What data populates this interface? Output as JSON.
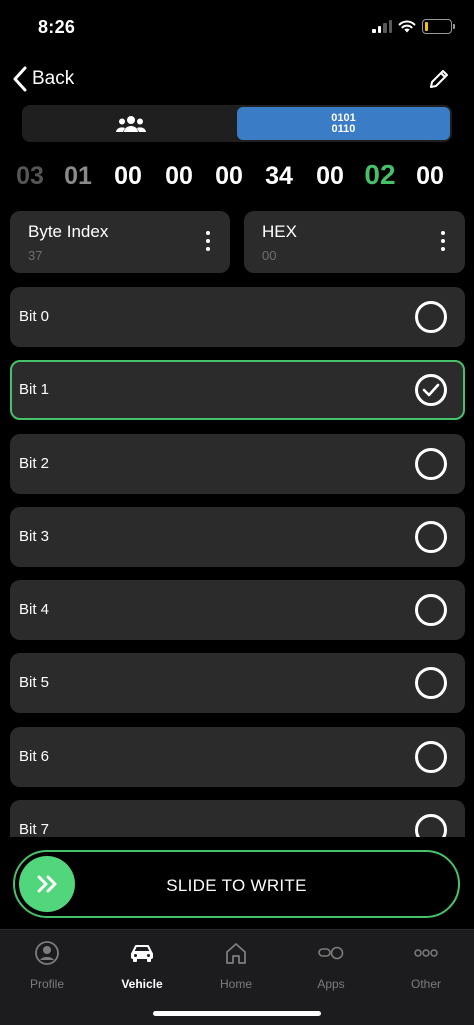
{
  "status_bar": {
    "time": "8:26"
  },
  "nav": {
    "back_label": "Back"
  },
  "segmented": {
    "binary_line1": "0101",
    "binary_line2": "0110"
  },
  "byte_strip": [
    "03",
    "01",
    "00",
    "00",
    "00",
    "34",
    "00",
    "02",
    "00"
  ],
  "byte_index": {
    "title": "Byte Index",
    "value": "37"
  },
  "hex": {
    "title": "HEX",
    "value": "00"
  },
  "bits": [
    {
      "label": "Bit 0",
      "checked": false
    },
    {
      "label": "Bit 1",
      "checked": true
    },
    {
      "label": "Bit 2",
      "checked": false
    },
    {
      "label": "Bit 3",
      "checked": false
    },
    {
      "label": "Bit 4",
      "checked": false
    },
    {
      "label": "Bit 5",
      "checked": false
    },
    {
      "label": "Bit 6",
      "checked": false
    },
    {
      "label": "Bit 7",
      "checked": false
    }
  ],
  "slide": {
    "label": "SLIDE TO WRITE"
  },
  "tabs": [
    {
      "label": "Profile",
      "icon": "profile-icon"
    },
    {
      "label": "Vehicle",
      "icon": "car-icon",
      "active": true
    },
    {
      "label": "Home",
      "icon": "home-icon"
    },
    {
      "label": "Apps",
      "icon": "apps-icon"
    },
    {
      "label": "Other",
      "icon": "more-icon"
    }
  ],
  "colors": {
    "accent_green": "#47c06a",
    "accent_blue": "#3b7cc6",
    "card": "#2b2b2b"
  }
}
